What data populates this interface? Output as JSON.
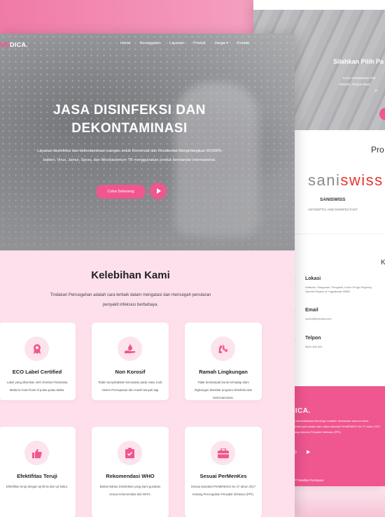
{
  "back_page": {
    "hero_title": "Silahkan Pilih Pa",
    "hero_text": [
      "Kami menawarkan Pak",
      "Sekolah, Tempat Ibadi",
      "R"
    ],
    "products_heading": "Pro",
    "brand": {
      "logo_part1": "sani",
      "logo_part2": "swiss",
      "name": "SANISWISS",
      "subtitle": "ANTISEPTIC AND DISINFECTANT"
    },
    "right_letter": "K",
    "contacts": [
      {
        "label": "Lokasi",
        "value": "Kalisoko, Margosari, Pengasih, Kulon Progo Regency, Special Region of Yogyakarta 55652"
      },
      {
        "label": "Email",
        "value": "contoh@medica.com"
      },
      {
        "label": "Telpon",
        "value": "0824 485 324"
      }
    ],
    "footer": {
      "logo": "DICA.",
      "text": "ami memanfaatkan teknologi mutakhir berstandar asional untuk disinfeksi permukaan dan udara standart PerMENKES No 27 tahun 2017 tentang edoman Penyakit Infeksius (PPI).",
      "copyright": "23 PT.Medika Purnawan"
    }
  },
  "nav": {
    "logo_prefix": "ME",
    "logo_suffix": "DICA.",
    "links": [
      "Home",
      "Keunggulan",
      "Layanan",
      "Produk",
      "Harga ▾",
      "Kontak"
    ]
  },
  "hero": {
    "title": "JASA DISINFEKSI DAN DEKONTAMINASI",
    "description": "Layanan desinfeksi dan dekontaminasi ruangan untuk Komersial dan Residential Menghilangkan 99,999% bakteri, Virus, Jamur, Spora, dan Micobacterium TB menggunakan produk berstandar internasional.",
    "cta_label": "Coba Sekarang"
  },
  "features": {
    "title": "Kelebihan Kami",
    "description": "Tindakan Pencegahan adalah cara terbaik dalam mengatasi dan mencegah penularan penyakit infeksius berbahaya.",
    "cards": [
      {
        "icon": "award-ribbon-icon",
        "title": "ECO Label Certified",
        "desc": "Label yang diberikan oleh Otoritas Pariwisata Malta ke hotel-hotel di pulau-pulau Malta."
      },
      {
        "icon": "hand-drop-icon",
        "title": "Non Korosif",
        "desc": "Tidak menyebabkan kerusakan pada mata, kulit, sistem Pernapasan dan masih banyak lagi"
      },
      {
        "icon": "recycle-icon",
        "title": "Ramah Lingkungan",
        "desc": "Tidak berdampak buruk terhadap alam lingkungan disekitar program disinfeksi dan Dekontaminasi."
      },
      {
        "icon": "thumbs-up-icon",
        "title": "Efektifitas Teruji",
        "desc": "Efektifitas teruji dengan uji klinis dan Uji kultur."
      },
      {
        "icon": "clipboard-check-icon",
        "title": "Rekomendasi WHO",
        "desc": "Bahan-bahan Disinfektan yang kami gunakan sesuai rekomendasi dari WHO."
      },
      {
        "icon": "medical-kit-icon",
        "title": "Sesuai PerMenKes",
        "desc": "Sesuai standard PerMENKES No 27 tahun 2017 tentang Pencegahan Penyakit Infeksius (PPI)."
      }
    ]
  },
  "colors": {
    "accent": "#f0568f",
    "soft_pink": "#fde0eb"
  }
}
